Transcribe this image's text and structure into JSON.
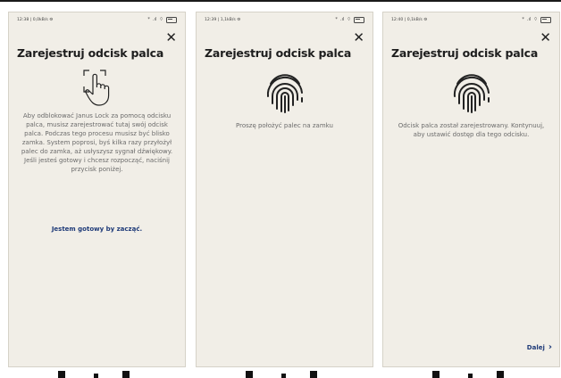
{
  "screens": [
    {
      "status_left": "12:38 | 0,0kB/s ⚙",
      "close_glyph": "✕",
      "title": "Zarejestruj odcisk palca",
      "icon": "finger-tap-icon",
      "description": "Aby odblokować Janus Lock za pomocą odcisku palca, musisz zarejestrować tutaj swój odcisk palca. Podczas tego procesu musisz być blisko zamka. System poprosi, byś kilka razy przyłożył palec do zamka, aż usłyszysz sygnał dźwiękowy. Jeśli jesteś gotowy i chcesz rozpocząć, naciśnij przycisk poniżej.",
      "action": "Jestem gotowy by zacząć."
    },
    {
      "status_left": "12:39 | 1,1kB/s ⚙",
      "close_glyph": "✕",
      "title": "Zarejestruj odcisk palca",
      "icon": "fingerprint-icon",
      "description": "Proszę położyć palec na zamku"
    },
    {
      "status_left": "12:40 | 0,1kB/s ⚙",
      "close_glyph": "✕",
      "title": "Zarejestruj odcisk palca",
      "icon": "fingerprint-icon",
      "description": "Odcisk palca został zarejestrowany. Kontynuuj, aby ustawić dostęp dla tego odcisku.",
      "next_label": "Dalej",
      "next_glyph": "›"
    }
  ],
  "status_icons": [
    "*",
    ".ıl",
    "⌔"
  ],
  "colors": {
    "background": "#f1eee7",
    "text": "#6b6b6b",
    "title": "#1d1d1d",
    "link": "#1e3a78"
  }
}
